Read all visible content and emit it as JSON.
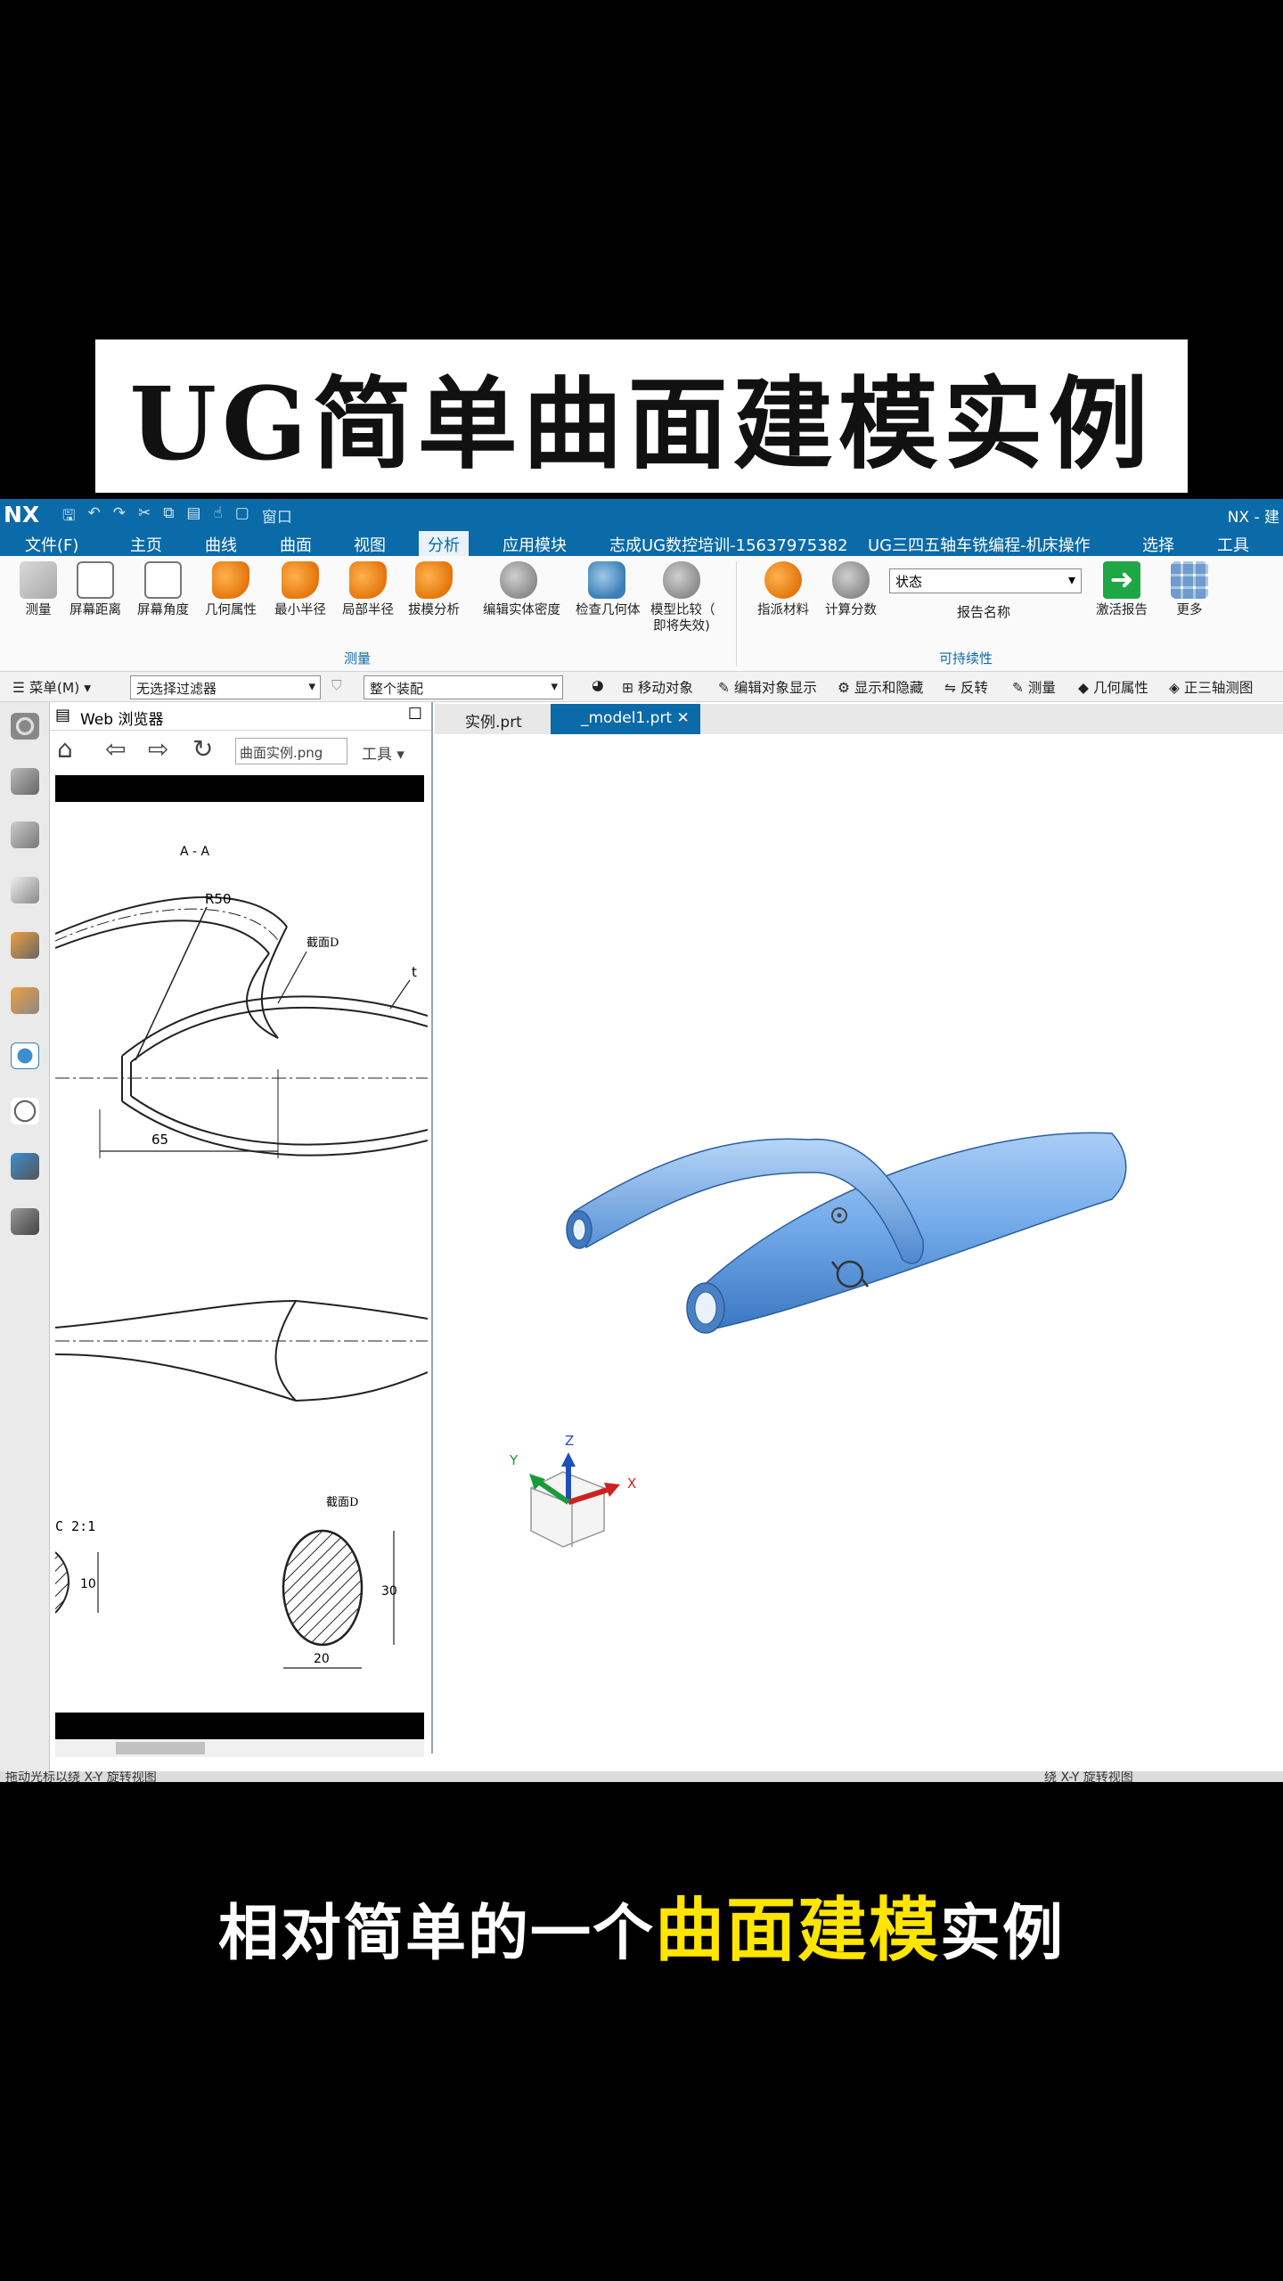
{
  "banner": {
    "title": "UG简单曲面建模实例"
  },
  "subtitle": {
    "part1": "相对简单的一个",
    "highlight": "曲面建模",
    "part2": "实例"
  },
  "titlebar": {
    "logo": "NX",
    "window_menu": "窗口",
    "right_text": "NX - 建"
  },
  "menubar": {
    "items": [
      "文件(F)",
      "主页",
      "曲线",
      "曲面",
      "视图",
      "分析",
      "应用模块",
      "志成UG数控培训-15637975382",
      "UG三四五轴车铣编程-机床操作",
      "选择",
      "工具"
    ],
    "active": "分析"
  },
  "ribbon": {
    "measure_group": {
      "label": "测量",
      "buttons": [
        "测量",
        "屏幕距离",
        "屏幕角度",
        "几何属性",
        "最小半径",
        "局部半径",
        "拔模分析",
        "编辑实体密度",
        "检查几何体",
        "模型比较（",
        "即将失效)"
      ]
    },
    "sustain_group": {
      "label": "可持续性",
      "buttons": [
        "指派材料",
        "计算分数"
      ],
      "status_value": "状态",
      "report_name_label": "报告名称",
      "activate_report": "激活报告",
      "more": "更多"
    }
  },
  "filterbar": {
    "menu": "菜单(M)",
    "type_filter": "无选择过滤器",
    "scope": "整个装配",
    "items": [
      "移动对象",
      "编辑对象显示",
      "显示和隐藏",
      "反转",
      "测量",
      "几何属性",
      "正三轴测图"
    ]
  },
  "browser": {
    "title": "Web 浏览器",
    "address": "曲面实例.png",
    "tools": "工具",
    "drawing": {
      "section_label": "A - A",
      "radius": "R50",
      "section_ref": "截面D",
      "thickness": "t",
      "length_dim": "65",
      "detail_label": "C  2:1",
      "detail_dim": "10",
      "section_d_label": "截面D",
      "dim_height": "30",
      "dim_width": "20"
    }
  },
  "tabs": [
    "实例.prt",
    "_model1.prt"
  ],
  "active_tab": "_model1.prt",
  "viewport": {
    "axes": [
      "X",
      "Y",
      "Z"
    ],
    "model_color": "#6fa8e8"
  },
  "statusbar": {
    "left": "拖动光标以绕 X-Y 旋转视图",
    "right": "绕 X-Y 旋转视图"
  }
}
